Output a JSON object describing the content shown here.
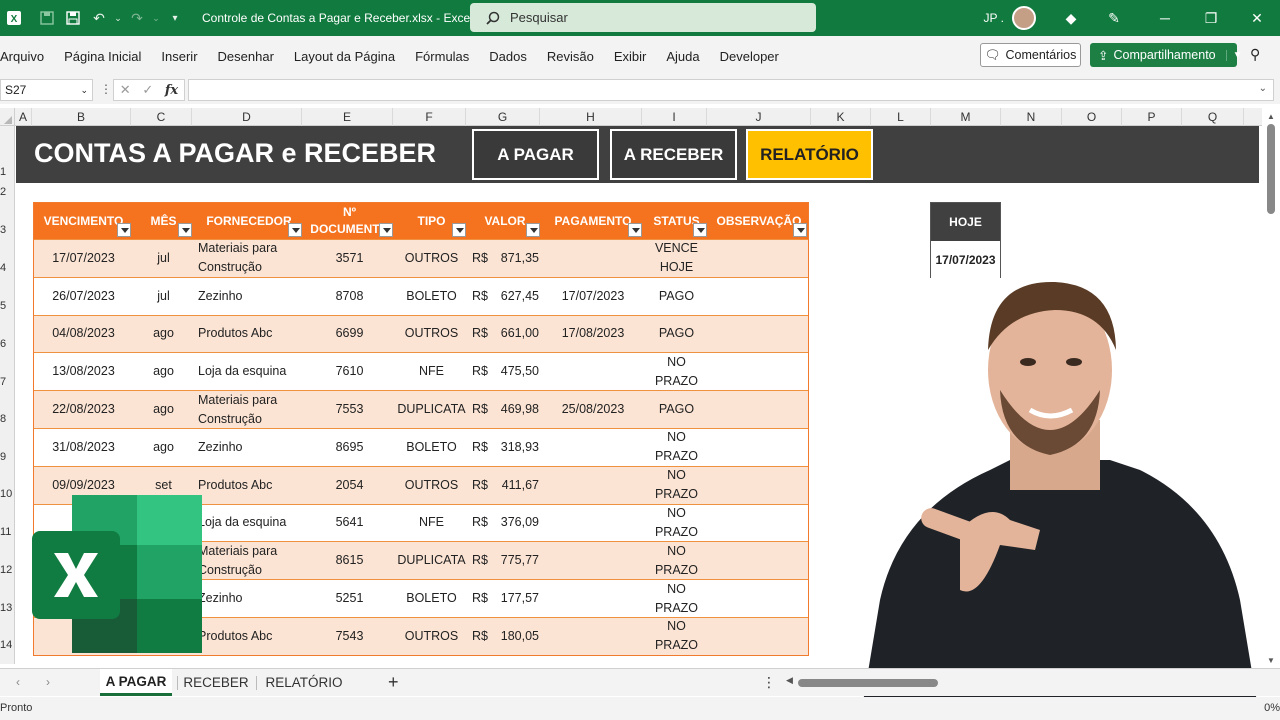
{
  "titlebar": {
    "doc_title": "Controle de Contas a Pagar e Receber.xlsx  -  Excel",
    "search_placeholder": "Pesquisar",
    "user_initials": "JP ."
  },
  "menu": [
    "Arquivo",
    "Página Inicial",
    "Inserir",
    "Desenhar",
    "Layout da Página",
    "Fórmulas",
    "Dados",
    "Revisão",
    "Exibir",
    "Ajuda",
    "Developer"
  ],
  "buttons": {
    "comments": "Comentários",
    "share": "Compartilhamento"
  },
  "formula_bar": {
    "name_box": "S27",
    "fx": "fx",
    "value": ""
  },
  "columns": [
    "A",
    "B",
    "C",
    "D",
    "E",
    "F",
    "G",
    "H",
    "I",
    "J",
    "K",
    "L",
    "M",
    "N",
    "O",
    "P",
    "Q"
  ],
  "rows": [
    "1",
    "2",
    "3",
    "4",
    "5",
    "6",
    "7",
    "8",
    "9",
    "10",
    "11",
    "12",
    "13",
    "14"
  ],
  "banner": {
    "title": "CONTAS A PAGAR e RECEBER",
    "nav": [
      "A PAGAR",
      "A RECEBER",
      "RELATÓRIO"
    ],
    "active_nav": "RELATÓRIO",
    "active_color": "#ffc000"
  },
  "table": {
    "header_color": "#f5731e",
    "stripe_color": "#fce4d4",
    "headers": [
      "VENCIMENTO",
      "MÊS",
      "FORNECEDOR",
      "Nº DOCUMENTO",
      "TIPO",
      "VALOR",
      "PAGAMENTO",
      "STATUS",
      "OBSERVAÇÃO"
    ],
    "rows": [
      {
        "vencimento": "17/07/2023",
        "mes": "jul",
        "fornecedor": "Materiais para Construção",
        "documento": "3571",
        "tipo": "OUTROS",
        "moeda": "R$",
        "valor": "871,35",
        "pagamento": "",
        "status": "VENCE HOJE",
        "observacao": ""
      },
      {
        "vencimento": "26/07/2023",
        "mes": "jul",
        "fornecedor": "Zezinho",
        "documento": "8708",
        "tipo": "BOLETO",
        "moeda": "R$",
        "valor": "627,45",
        "pagamento": "17/07/2023",
        "status": "PAGO",
        "observacao": ""
      },
      {
        "vencimento": "04/08/2023",
        "mes": "ago",
        "fornecedor": "Produtos Abc",
        "documento": "6699",
        "tipo": "OUTROS",
        "moeda": "R$",
        "valor": "661,00",
        "pagamento": "17/08/2023",
        "status": "PAGO",
        "observacao": ""
      },
      {
        "vencimento": "13/08/2023",
        "mes": "ago",
        "fornecedor": "Loja da esquina",
        "documento": "7610",
        "tipo": "NFE",
        "moeda": "R$",
        "valor": "475,50",
        "pagamento": "",
        "status": "NO PRAZO",
        "observacao": ""
      },
      {
        "vencimento": "22/08/2023",
        "mes": "ago",
        "fornecedor": "Materiais para Construção",
        "documento": "7553",
        "tipo": "DUPLICATA",
        "moeda": "R$",
        "valor": "469,98",
        "pagamento": "25/08/2023",
        "status": "PAGO",
        "observacao": ""
      },
      {
        "vencimento": "31/08/2023",
        "mes": "ago",
        "fornecedor": "Zezinho",
        "documento": "8695",
        "tipo": "BOLETO",
        "moeda": "R$",
        "valor": "318,93",
        "pagamento": "",
        "status": "NO PRAZO",
        "observacao": ""
      },
      {
        "vencimento": "09/09/2023",
        "mes": "set",
        "fornecedor": "Produtos Abc",
        "documento": "2054",
        "tipo": "OUTROS",
        "moeda": "R$",
        "valor": "411,67",
        "pagamento": "",
        "status": "NO PRAZO",
        "observacao": ""
      },
      {
        "vencimento": "18/0",
        "mes": "",
        "fornecedor": "Loja da esquina",
        "documento": "5641",
        "tipo": "NFE",
        "moeda": "R$",
        "valor": "376,09",
        "pagamento": "",
        "status": "NO PRAZO",
        "observacao": ""
      },
      {
        "vencimento": "",
        "mes": "",
        "fornecedor": "Materiais para Construção",
        "documento": "8615",
        "tipo": "DUPLICATA",
        "moeda": "R$",
        "valor": "775,77",
        "pagamento": "",
        "status": "NO PRAZO",
        "observacao": ""
      },
      {
        "vencimento": "",
        "mes": "",
        "fornecedor": "Zezinho",
        "documento": "5251",
        "tipo": "BOLETO",
        "moeda": "R$",
        "valor": "177,57",
        "pagamento": "",
        "status": "NO PRAZO",
        "observacao": ""
      },
      {
        "vencimento": "15/1",
        "mes": "",
        "fornecedor": "Produtos Abc",
        "documento": "7543",
        "tipo": "OUTROS",
        "moeda": "R$",
        "valor": "180,05",
        "pagamento": "",
        "status": "NO PRAZO",
        "observacao": ""
      }
    ]
  },
  "today_box": {
    "label": "HOJE",
    "value": "17/07/2023"
  },
  "sheet_tabs": [
    "A PAGAR",
    "RECEBER",
    "RELATÓRIO"
  ],
  "active_sheet": "A PAGAR",
  "status_bar": {
    "status": "Pronto",
    "zoom": "0%"
  },
  "icons": {
    "app": "excel-icon",
    "autosave": "autosave-icon",
    "save": "save-icon",
    "undo": "undo-icon",
    "redo": "redo-icon",
    "search": "search-icon",
    "comment": "comment-icon",
    "share": "share-icon",
    "diamond": "diamond-icon",
    "pen": "pen-icon"
  }
}
